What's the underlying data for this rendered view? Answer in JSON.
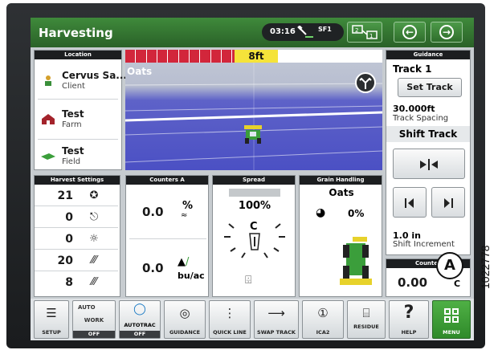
{
  "header": {
    "title": "Harvesting",
    "time": "03:16",
    "signal": "SF1",
    "switch_icon": "display-switch-icon",
    "back_icon": "arrow-left-icon",
    "forward_icon": "arrow-right-icon"
  },
  "location": {
    "heading": "Location",
    "client_name": "Cervus Sa...",
    "client_label": "Client",
    "farm_name": "Test",
    "farm_label": "Farm",
    "field_name": "Test",
    "field_label": "Field"
  },
  "map": {
    "swath_width": "8ft",
    "crop": "Oats"
  },
  "guidance": {
    "heading": "Guidance",
    "track": "Track 1",
    "set_track": "Set Track",
    "spacing_value": "30.000ft",
    "spacing_label": "Track Spacing",
    "shift_track": "Shift Track",
    "shift_increment_value": "1.0 in",
    "shift_increment_label": "Shift Increment"
  },
  "counter_b": {
    "heading": "Counte",
    "value": "0.00",
    "unit_fragment": "C"
  },
  "harvest_settings": {
    "heading": "Harvest Settings",
    "rows": [
      {
        "value": "21",
        "icon": "rotor-speed-icon"
      },
      {
        "value": "0",
        "icon": "fan-speed-icon"
      },
      {
        "value": "0",
        "icon": "feeder-speed-icon"
      },
      {
        "value": "20",
        "icon": "concave-icon"
      },
      {
        "value": "8",
        "icon": "sieve-icon"
      }
    ]
  },
  "counters_a": {
    "heading": "Counters A",
    "value1": "0.0",
    "unit1": "%",
    "value2": "0.0",
    "unit2": "bu/ac"
  },
  "spread": {
    "heading": "Spread",
    "value": "100%",
    "center": "C"
  },
  "grain_handling": {
    "heading": "Grain Handling",
    "crop": "Oats",
    "value": "0%"
  },
  "toolbar": {
    "setup": "SETUP",
    "auto": "AUTO",
    "work": "WORK",
    "work_state": "OFF",
    "autotrac": "AUTOTRAC",
    "autotrac_state": "OFF",
    "guidance": "GUIDANCE",
    "quick_line": "QUICK LINE",
    "swap_track": "SWAP TRACK",
    "ica2": "ICA2",
    "residue": "RESIDUE",
    "help": "HELP",
    "menu": "MENU"
  },
  "callout_label": "A",
  "figure_code": "1022778",
  "colors": {
    "header_green": "#2f6e2c",
    "menu_green": "#3e9a35",
    "swath_red": "#d2263b",
    "swath_yellow": "#f5e33a",
    "field_blue": "#4b50c4"
  }
}
